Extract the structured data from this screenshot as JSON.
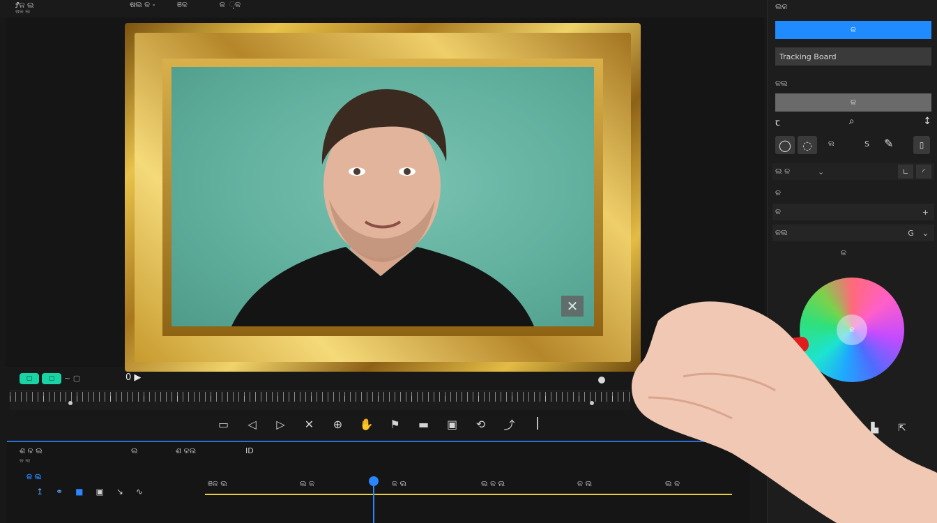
{
  "topbar": {
    "app_title": "Ꝭ଺ଳ ଲ",
    "app_subtitle": "ଷଳ ଲ",
    "menu": [
      "ଷଲ ଳ -",
      "ଞଳ",
      "ଳ ଼ଳ"
    ]
  },
  "preview": {
    "overlay_button": "✕"
  },
  "transport": {
    "tag_a": "▢",
    "tag_b": "▢",
    "time_label": "~ ▢",
    "play_marker": "0 ▶"
  },
  "toolbar": {
    "icons": [
      "monitor-icon",
      "back-icon",
      "play-icon",
      "cut-icon",
      "effects-icon",
      "hand-icon",
      "flag-icon",
      "crop-icon",
      "save-icon",
      "share-icon",
      "link-icon"
    ],
    "glyphs": [
      "▭",
      "◁",
      "▷",
      "✕",
      "⊕",
      "✋",
      "⚑",
      "▬",
      "▣",
      "⟲",
      "⤴"
    ]
  },
  "timeline": {
    "header_left": "ଶ ଳ ଲ",
    "header_left_sub": "ଳ ଲ",
    "header_mid": "ଲ",
    "header_right": "ଶ ଳଲ",
    "header_id": "ID",
    "track_label": "ଳ ଲ",
    "clip_labels": [
      "ଞଳ ଲ",
      "ଲ ଳ",
      "ଳ ଲ",
      "ଲ ଳ ଲ",
      "ଳ ଲ",
      "ଲ ଳ"
    ]
  },
  "right_panel": {
    "section_title": "ଲଳ",
    "primary_button": "ଳ",
    "field_a": "Tracking Board",
    "section_b": "ଳଲ",
    "secondary_button": "ଳ",
    "mode_label": "ଲ",
    "dropdown": "ଲ ଳ",
    "section_c": "ଳ",
    "field_b": "ଳ",
    "field_c": "ଳଲ",
    "wheel_title": "ଳ",
    "wheel_center": "ଳ"
  },
  "colors": {
    "accent": "#1f8bff",
    "playhead": "#2a86ff",
    "track": "#e7cf3a",
    "backdrop": "#5fae9c"
  }
}
